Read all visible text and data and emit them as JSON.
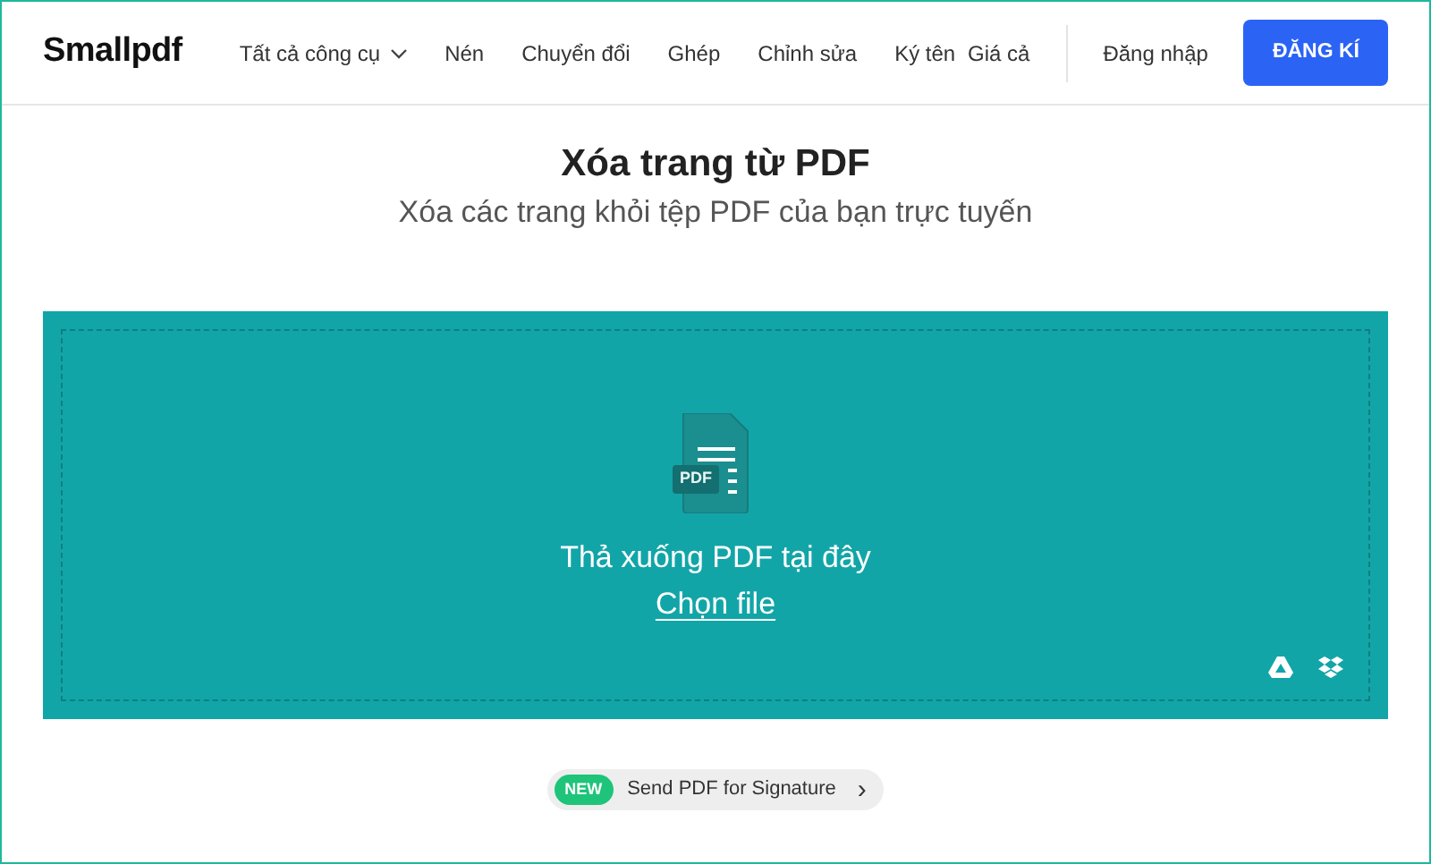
{
  "brand": "Smallpdf",
  "nav": [
    {
      "label": "Tất cả công cụ",
      "kind": "dropdown"
    },
    {
      "label": "Nén",
      "kind": "link"
    },
    {
      "label": "Chuyển đổi",
      "kind": "link"
    },
    {
      "label": "Ghép",
      "kind": "link"
    },
    {
      "label": "Chỉnh sửa",
      "kind": "link"
    },
    {
      "label": "Ký tên",
      "kind": "link"
    }
  ],
  "pricing": "Giá cả",
  "login": "Đăng nhập",
  "signup": "ĐĂNG KÍ",
  "title": "Xóa trang từ PDF",
  "subtitle": "Xóa các trang khỏi tệp PDF của bạn trực tuyến",
  "dropzone": {
    "file_badge": "PDF",
    "prompt": "Thả xuống PDF tại đây",
    "choose": "Chọn file"
  },
  "promo": {
    "badge": "NEW",
    "text": "Send PDF for Signature",
    "arrow": "›"
  }
}
